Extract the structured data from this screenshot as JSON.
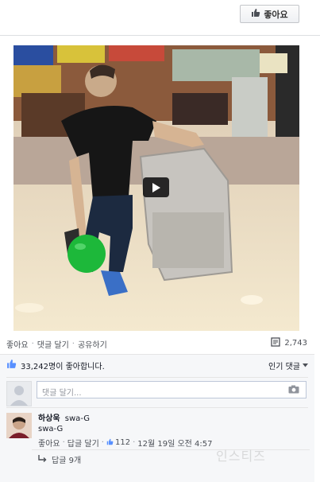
{
  "header": {
    "like_page_label": "좋아요"
  },
  "video": {
    "play_icon": "play-icon"
  },
  "actions": {
    "like": "좋아요",
    "comment": "댓글 달기",
    "share": "공유하기",
    "separator": "·",
    "shares_count": "2,743"
  },
  "likes": {
    "summary": "33,242명이 좋아합니다.",
    "sort_label": "인기 댓글"
  },
  "composer": {
    "placeholder": "댓글 달기..."
  },
  "comment": {
    "author": "하상욱",
    "author_note": "swa-G",
    "text": "swa-G",
    "like": "좋아요",
    "reply": "답글 달기",
    "like_count": "112",
    "timestamp": "12월 19일 오전 4:57",
    "separator": "·"
  },
  "replies": {
    "label": "답글 9개"
  },
  "watermark": "인스티즈",
  "colors": {
    "link_blue": "#3b5998",
    "muted": "#4b4f56",
    "ball_green": "#1db83a"
  }
}
